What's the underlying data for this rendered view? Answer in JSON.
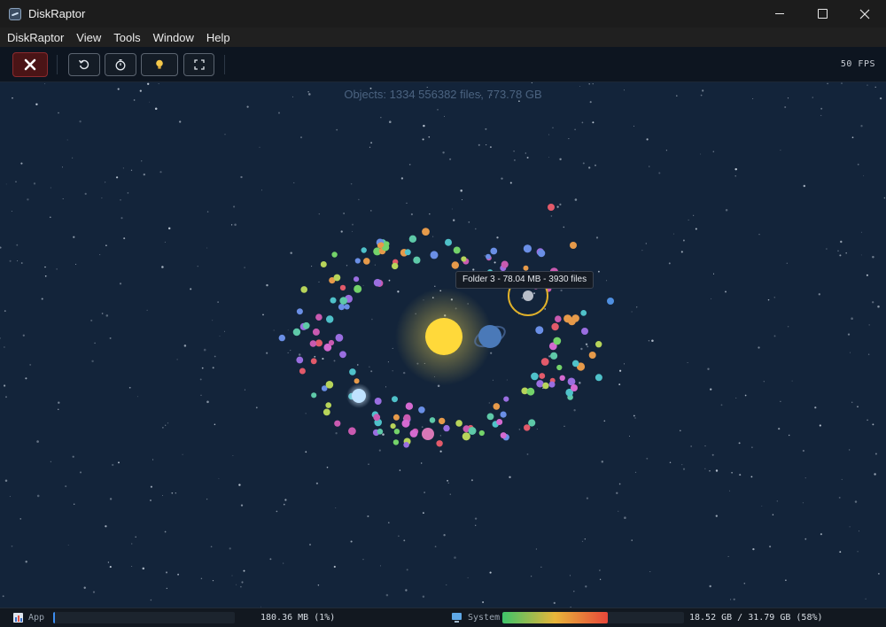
{
  "window": {
    "title": "DiskRaptor",
    "minimize": "–",
    "maximize": "□",
    "close": "✕"
  },
  "menu": [
    "DiskRaptor",
    "View",
    "Tools",
    "Window",
    "Help"
  ],
  "toolbar": {
    "buttons": [
      {
        "name": "close-scan-button",
        "icon": "x-icon",
        "color": "#ffffff"
      },
      {
        "name": "refresh-button",
        "icon": "refresh-icon"
      },
      {
        "name": "timer-button",
        "icon": "stopwatch-icon"
      },
      {
        "name": "hint-button",
        "icon": "lightbulb-icon",
        "color": "#f5c84a"
      },
      {
        "name": "fullscreen-button",
        "icon": "fullscreen-icon"
      }
    ],
    "fps": "50 FPS"
  },
  "scene": {
    "objects_text": "Objects: 1334   556382 files, 773.78 GB",
    "tooltip": "Folder 3 - 78.04 MB - 3930 files",
    "sun_color": "#ffd93a",
    "background": "#13243a"
  },
  "status": {
    "app": {
      "label": "App",
      "value": "180.36 MB (1%)",
      "fraction": 0.01,
      "color": "#3c8df0"
    },
    "system": {
      "label": "System",
      "value": "18.52 GB / 31.79 GB (58%)",
      "fraction": 0.58,
      "gradient": [
        "#3ec46a",
        "#e8b53a",
        "#e8473a"
      ]
    }
  }
}
